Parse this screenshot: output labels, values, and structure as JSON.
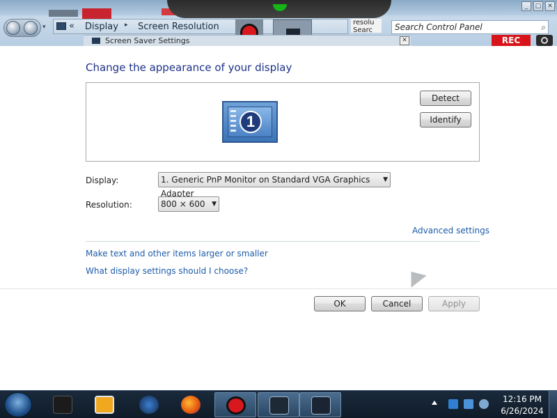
{
  "window": {
    "address": {
      "chevron": "«",
      "crumbs": [
        "Display",
        "Screen Resolution"
      ],
      "separator": "▸"
    },
    "search": {
      "fragment_text": "resolu Searc",
      "placeholder": "Search Control Panel",
      "icon": "search-icon"
    },
    "overlay": {
      "rec_badge": "REC",
      "screensaver_title": "Screen Saver Settings"
    },
    "controls": {
      "minimize": "_",
      "maximize": "□",
      "close": "✕"
    }
  },
  "main": {
    "heading": "Change the appearance of your display",
    "monitor": {
      "number": "1"
    },
    "detect_button": "Detect",
    "identify_button": "Identify",
    "display_label": "Display:",
    "display_value": "1. Generic PnP Monitor on Standard VGA Graphics Adapter",
    "resolution_label": "Resolution:",
    "resolution_value": "800 × 600",
    "advanced_settings_link": "Advanced settings",
    "links": [
      "Make text and other items larger or smaller",
      "What display settings should I choose?"
    ],
    "ok_button": "OK",
    "cancel_button": "Cancel",
    "apply_button": "Apply"
  },
  "taskbar": {
    "clock_time": "12:16 PM",
    "clock_date": "6/26/2024",
    "items": [
      "terminal",
      "media-player",
      "app-globe",
      "firefox",
      "recorder",
      "display-settings",
      "monitor"
    ]
  },
  "colors": {
    "heading": "#1e3287",
    "link": "#1c5ba8",
    "taskbar": "#0f1b28",
    "rec": "#d7141a"
  }
}
